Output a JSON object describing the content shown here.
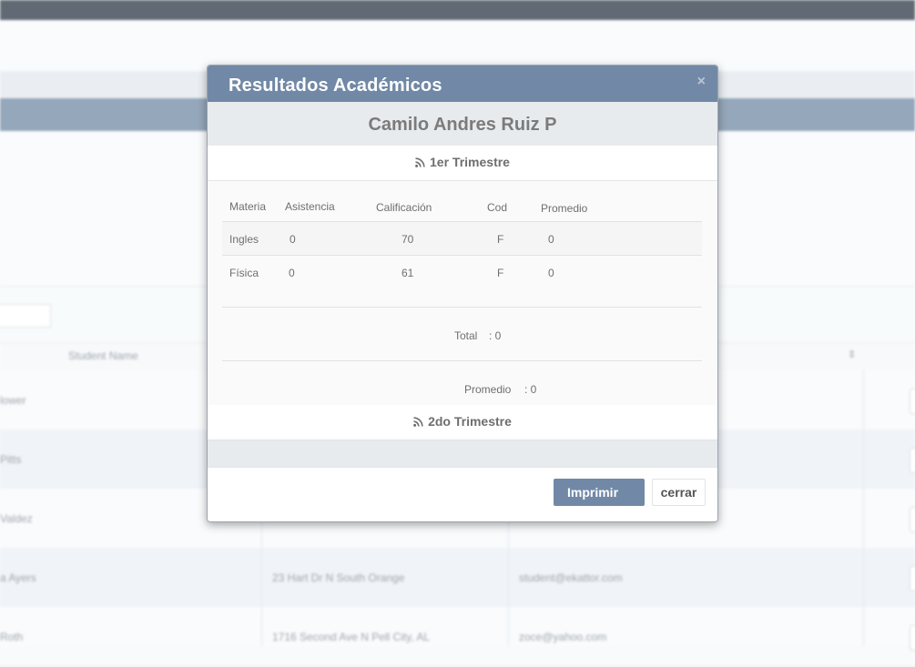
{
  "background": {
    "table_header": {
      "student_name": "Student Name"
    },
    "rows": [
      {
        "name": "lower",
        "address": "",
        "email": ""
      },
      {
        "name": "Pitts",
        "address": "",
        "email": ""
      },
      {
        "name": "Valdez",
        "address": "",
        "email": ""
      },
      {
        "name": "a Ayers",
        "address": "23 Hart Dr N South Orange",
        "email": "student@ekattor.com"
      },
      {
        "name": "Roth",
        "address": "1716 Second Ave N Pell City, AL",
        "email": "zoce@yahoo.com"
      }
    ]
  },
  "modal": {
    "title": "Resultados Académicos",
    "close_symbol": "×",
    "student_name": "Camilo Andres Ruiz P",
    "terms": [
      {
        "label": "1er Trimestre",
        "columns": [
          "Materia",
          "Asistencia",
          "Calificación",
          "Cod",
          "Promedio"
        ],
        "rows": [
          {
            "materia": "Ingles",
            "asistencia": "0",
            "calificacion": "70",
            "cod": "F",
            "promedio": "0"
          },
          {
            "materia": "Física",
            "asistencia": "0",
            "calificacion": "61",
            "cod": "F",
            "promedio": "0"
          }
        ],
        "total_label": "Total",
        "total_value": ": 0",
        "promedio_label": "Promedio",
        "promedio_value": ": 0"
      },
      {
        "label": "2do Trimestre"
      }
    ],
    "buttons": {
      "print": "Imprimir",
      "close": "cerrar"
    }
  },
  "colors": {
    "accent": "#7189a6",
    "topbar": "#3f4956"
  }
}
